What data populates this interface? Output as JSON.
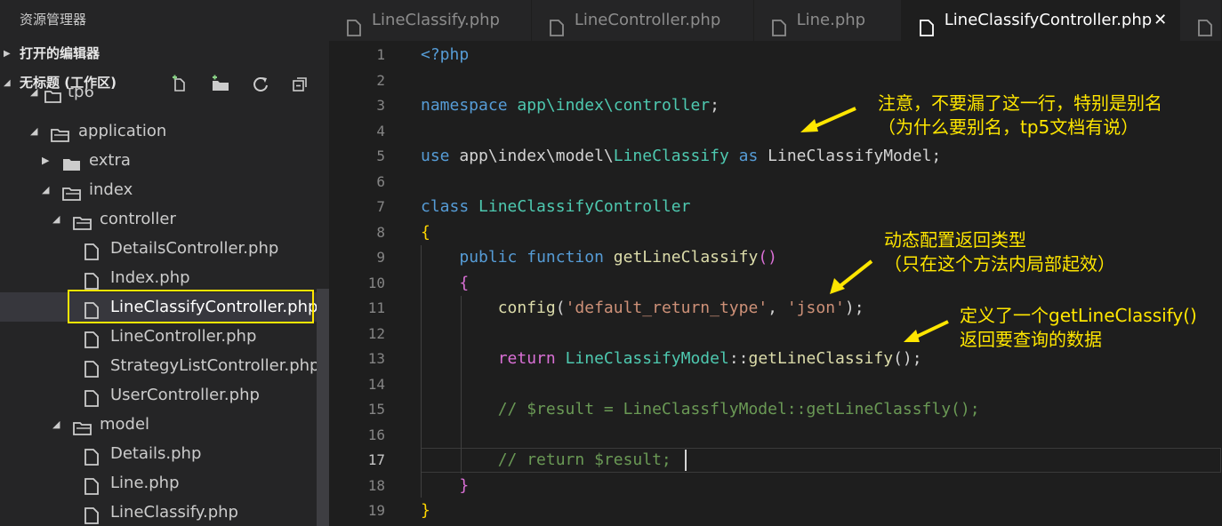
{
  "sidebar": {
    "title": "资源管理器",
    "open_editors": "打开的编辑器",
    "workspace": "无标题 (工作区)",
    "tree": [
      {
        "label": "tp6",
        "depth": 0,
        "kind": "folder-open"
      },
      {
        "label": "application",
        "depth": 1,
        "kind": "folder-open"
      },
      {
        "label": "extra",
        "depth": 2,
        "kind": "folder-closed"
      },
      {
        "label": "index",
        "depth": 2,
        "kind": "folder-open"
      },
      {
        "label": "controller",
        "depth": 3,
        "kind": "folder-open"
      },
      {
        "label": "DetailsController.php",
        "depth": 4,
        "kind": "file"
      },
      {
        "label": "Index.php",
        "depth": 4,
        "kind": "file"
      },
      {
        "label": "LineClassifyController.php",
        "depth": 4,
        "kind": "file",
        "selected": true
      },
      {
        "label": "LineController.php",
        "depth": 4,
        "kind": "file"
      },
      {
        "label": "StrategyListController.php",
        "depth": 4,
        "kind": "file"
      },
      {
        "label": "UserController.php",
        "depth": 4,
        "kind": "file"
      },
      {
        "label": "model",
        "depth": 3,
        "kind": "folder-open"
      },
      {
        "label": "Details.php",
        "depth": 4,
        "kind": "file"
      },
      {
        "label": "Line.php",
        "depth": 4,
        "kind": "file"
      },
      {
        "label": "LineClassify.php",
        "depth": 4,
        "kind": "file"
      }
    ]
  },
  "tabs": [
    {
      "label": "LineClassify.php"
    },
    {
      "label": "LineController.php"
    },
    {
      "label": "Line.php"
    },
    {
      "label": "LineClassifyController.php",
      "active": true,
      "close": "✕"
    }
  ],
  "editor": {
    "line_numbers": [
      "1",
      "2",
      "3",
      "4",
      "5",
      "6",
      "7",
      "8",
      "9",
      "10",
      "11",
      "12",
      "13",
      "14",
      "15",
      "16",
      "17",
      "18",
      "19"
    ],
    "current_line": 17
  },
  "annotations": {
    "note1_line1": "注意，不要漏了这一行，特别是别名",
    "note1_line2": "（为什么要别名，tp5文档有说）",
    "note2_line1": "动态配置返回类型",
    "note2_line2": "（只在这个方法内局部起效）",
    "note3_line1": "定义了一个getLineClassify()",
    "note3_line2": "返回要查询的数据"
  },
  "colors": {
    "annotation": "#ffe600",
    "selection_box": "#ffe600"
  }
}
